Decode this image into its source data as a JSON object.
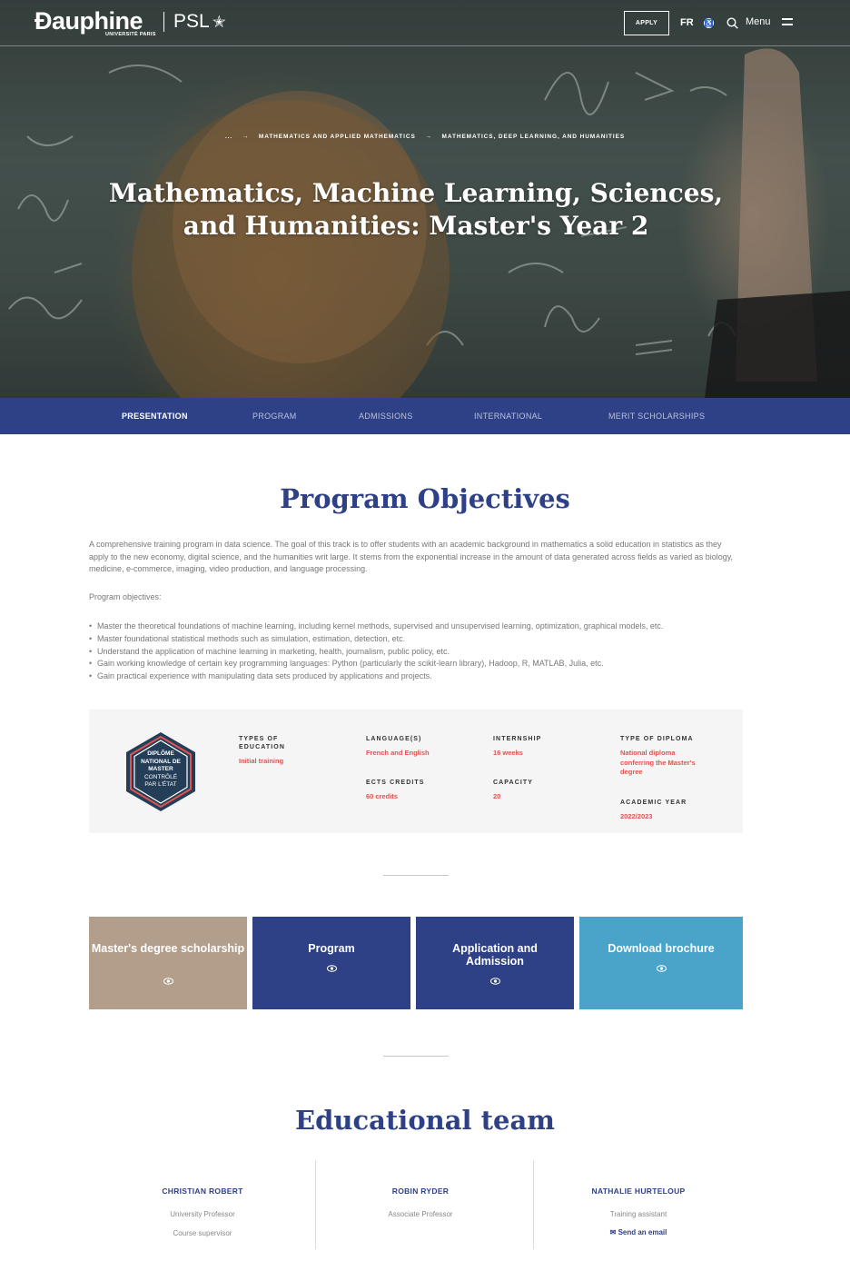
{
  "header": {
    "logo_name": "Ɖauphine",
    "logo_sub": "UNIVERSITÉ PARIS",
    "psl": "PSL",
    "apply": "APPLY",
    "lang": "FR",
    "menu": "Menu"
  },
  "hero": {
    "breadcrumb": [
      "...",
      "MATHEMATICS AND APPLIED MATHEMATICS",
      "MATHEMATICS, DEEP LEARNING, AND HUMANITIES"
    ],
    "title": "Mathematics, Machine Learning, Sciences, and Humanities: Master's Year 2"
  },
  "tabs": [
    {
      "label": "PRESENTATION",
      "active": true
    },
    {
      "label": "PROGRAM",
      "active": false
    },
    {
      "label": "ADMISSIONS",
      "active": false
    },
    {
      "label": "INTERNATIONAL",
      "active": false
    },
    {
      "label": "MERIT SCHOLARSHIPS",
      "active": false
    }
  ],
  "objectives": {
    "title": "Program Objectives",
    "intro": "A comprehensive training program in data science. The goal of this track is to offer students with an academic background in mathematics a solid education in statistics as they apply to the new economy, digital science, and the humanities writ large. It stems from the exponential increase in the amount of data generated across fields as varied as biology, medicine, e-commerce, imaging, video production, and language processing.",
    "lead": "Program objectives:",
    "bullets": [
      "Master the theoretical foundations of machine learning, including kernel methods, supervised and unsupervised learning, optimization, graphical models, etc.",
      "Master foundational statistical methods such as simulation, estimation, detection, etc.",
      "Understand the application of machine learning in marketing, health, journalism, public policy, etc.",
      "Gain working knowledge of certain key programming languages: Python (particularly the scikit-learn library), Hadoop, R, MATLAB, Julia, etc.",
      "Gain practical experience with manipulating data sets produced by applications and projects."
    ]
  },
  "info": {
    "badge": [
      "DIPLÔME",
      "NATIONAL DE",
      "MASTER",
      "CONTRÔLÉ",
      "PAR L'ÉTAT"
    ],
    "types_label": "TYPES OF EDUCATION",
    "types_value": "Initial training",
    "language_label": "LANGUAGE(S)",
    "language_value": "French and English",
    "internship_label": "INTERNSHIP",
    "internship_value": "16 weeks",
    "diploma_label": "TYPE OF DIPLOMA",
    "diploma_value": "National diploma conferring the Master's degree",
    "ects_label": "ECTS CREDITS",
    "ects_value": "60 credits",
    "capacity_label": "CAPACITY",
    "capacity_value": "20",
    "year_label": "ACADEMIC YEAR",
    "year_value": "2022/2023"
  },
  "cards": [
    {
      "label": "Master's degree scholarship",
      "color": "#b29e8b"
    },
    {
      "label": "Program",
      "color": "#2f4186"
    },
    {
      "label": "Application and Admission",
      "color": "#2f4186"
    },
    {
      "label": "Download brochure",
      "color": "#4aa3c8"
    }
  ],
  "team": {
    "title": "Educational team",
    "members": [
      {
        "name": "CHRISTIAN ROBERT",
        "role": "University Professor",
        "extra": "Course supervisor"
      },
      {
        "name": "ROBIN RYDER",
        "role": "Associate Professor"
      },
      {
        "name": "NATHALIE HURTELOUP",
        "role": "Training assistant",
        "email_label": "Send an email"
      }
    ]
  },
  "colors": {
    "brand_blue": "#2f4186",
    "accent_red": "#e0534f",
    "scholarship_tan": "#b29e8b",
    "brochure_blue": "#4aa3c8"
  },
  "icons": [
    "accessibility-icon",
    "search-icon",
    "menu-icon",
    "arrow-right-icon",
    "eye-icon",
    "email-icon",
    "diploma-badge"
  ]
}
